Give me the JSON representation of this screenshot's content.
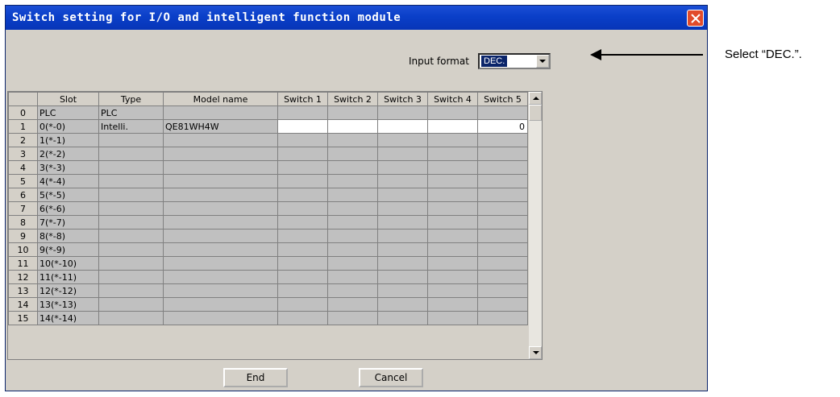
{
  "window": {
    "title": "Switch setting for I/O and intelligent function module"
  },
  "input_format": {
    "label": "Input format",
    "selected": "DEC."
  },
  "table": {
    "columns": [
      "Slot",
      "Type",
      "Model name",
      "Switch 1",
      "Switch 2",
      "Switch 3",
      "Switch 4",
      "Switch 5"
    ],
    "rows": [
      {
        "num": "0",
        "slot": "PLC",
        "type": "PLC",
        "model": "",
        "s1": "",
        "s2": "",
        "s3": "",
        "s4": "",
        "s5": ""
      },
      {
        "num": "1",
        "slot": "0(*-0)",
        "type": "Intelli.",
        "model": "QE81WH4W",
        "s1": "",
        "s2": "",
        "s3": "",
        "s4": "",
        "s5": "0"
      },
      {
        "num": "2",
        "slot": "1(*-1)",
        "type": "",
        "model": "",
        "s1": "",
        "s2": "",
        "s3": "",
        "s4": "",
        "s5": ""
      },
      {
        "num": "3",
        "slot": "2(*-2)",
        "type": "",
        "model": "",
        "s1": "",
        "s2": "",
        "s3": "",
        "s4": "",
        "s5": ""
      },
      {
        "num": "4",
        "slot": "3(*-3)",
        "type": "",
        "model": "",
        "s1": "",
        "s2": "",
        "s3": "",
        "s4": "",
        "s5": ""
      },
      {
        "num": "5",
        "slot": "4(*-4)",
        "type": "",
        "model": "",
        "s1": "",
        "s2": "",
        "s3": "",
        "s4": "",
        "s5": ""
      },
      {
        "num": "6",
        "slot": "5(*-5)",
        "type": "",
        "model": "",
        "s1": "",
        "s2": "",
        "s3": "",
        "s4": "",
        "s5": ""
      },
      {
        "num": "7",
        "slot": "6(*-6)",
        "type": "",
        "model": "",
        "s1": "",
        "s2": "",
        "s3": "",
        "s4": "",
        "s5": ""
      },
      {
        "num": "8",
        "slot": "7(*-7)",
        "type": "",
        "model": "",
        "s1": "",
        "s2": "",
        "s3": "",
        "s4": "",
        "s5": ""
      },
      {
        "num": "9",
        "slot": "8(*-8)",
        "type": "",
        "model": "",
        "s1": "",
        "s2": "",
        "s3": "",
        "s4": "",
        "s5": ""
      },
      {
        "num": "10",
        "slot": "9(*-9)",
        "type": "",
        "model": "",
        "s1": "",
        "s2": "",
        "s3": "",
        "s4": "",
        "s5": ""
      },
      {
        "num": "11",
        "slot": "10(*-10)",
        "type": "",
        "model": "",
        "s1": "",
        "s2": "",
        "s3": "",
        "s4": "",
        "s5": ""
      },
      {
        "num": "12",
        "slot": "11(*-11)",
        "type": "",
        "model": "",
        "s1": "",
        "s2": "",
        "s3": "",
        "s4": "",
        "s5": ""
      },
      {
        "num": "13",
        "slot": "12(*-12)",
        "type": "",
        "model": "",
        "s1": "",
        "s2": "",
        "s3": "",
        "s4": "",
        "s5": ""
      },
      {
        "num": "14",
        "slot": "13(*-13)",
        "type": "",
        "model": "",
        "s1": "",
        "s2": "",
        "s3": "",
        "s4": "",
        "s5": ""
      },
      {
        "num": "15",
        "slot": "14(*-14)",
        "type": "",
        "model": "",
        "s1": "",
        "s2": "",
        "s3": "",
        "s4": "",
        "s5": ""
      }
    ]
  },
  "buttons": {
    "end": "End",
    "cancel": "Cancel"
  },
  "annotation": {
    "text": "Select “DEC.”."
  }
}
